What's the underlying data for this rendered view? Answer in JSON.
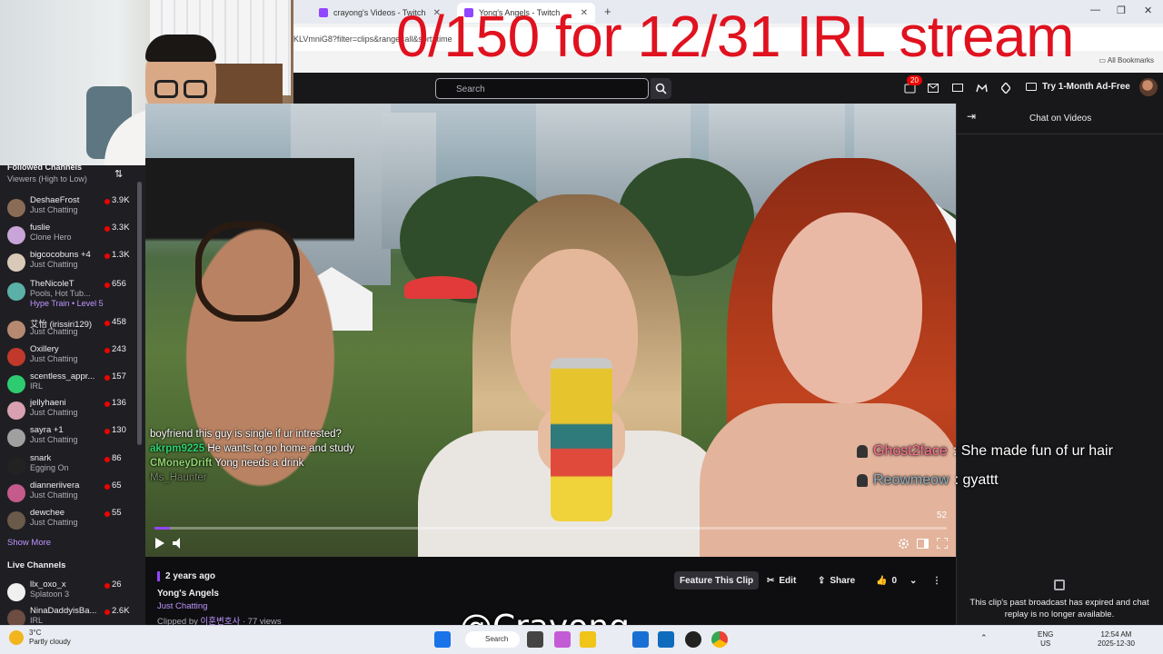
{
  "overlay": {
    "title": "0/150 for 12/31 IRL stream",
    "watermark": "@Crayong"
  },
  "browser": {
    "tabs": [
      {
        "label": "crayong's Videos - Twitch"
      },
      {
        "label": "Yong's Angels - Twitch"
      }
    ],
    "url": "KLVmniG8?filter=clips&range=all&sort=time",
    "bookmarks_label": "All Bookmarks"
  },
  "twitch_nav": {
    "search_placeholder": "Search",
    "notification_count": "20",
    "ad_free_label": "Try 1-Month Ad-Free"
  },
  "sidebar": {
    "title": "Followed Channels",
    "sort_label": "Viewers (High to Low)",
    "channels": [
      {
        "name": "DeshaeFrost",
        "game": "Just Chatting",
        "viewers": "3.9K",
        "avatar_color": "#8a6b55"
      },
      {
        "name": "fuslie",
        "game": "Clone Hero",
        "viewers": "3.3K",
        "avatar_color": "#c9a4d8"
      },
      {
        "name": "bigcocobuns +4",
        "game": "Just Chatting",
        "viewers": "1.3K",
        "avatar_color": "#d9c9b8"
      },
      {
        "name": "TheNicoleT",
        "game": "Pools, Hot Tub...",
        "extra": "Hype Train • Level 5",
        "viewers": "656",
        "avatar_color": "#5bb0a8"
      },
      {
        "name": "艾怡 (irissiri129)",
        "game": "Just Chatting",
        "viewers": "458",
        "avatar_color": "#b58a70"
      },
      {
        "name": "Oxillery",
        "game": "Just Chatting",
        "viewers": "243",
        "avatar_color": "#c0392b"
      },
      {
        "name": "scentless_appr...",
        "game": "IRL",
        "viewers": "157",
        "avatar_color": "#2ecc71"
      },
      {
        "name": "jellyhaeni",
        "game": "Just Chatting",
        "viewers": "136",
        "avatar_color": "#d8a0b0"
      },
      {
        "name": "sayra +1",
        "game": "Just Chatting",
        "viewers": "130",
        "avatar_color": "#a0a0a0"
      },
      {
        "name": "snark",
        "game": "Egging On",
        "viewers": "86",
        "avatar_color": "#222222"
      },
      {
        "name": "dianneriivera",
        "game": "Just Chatting",
        "viewers": "65",
        "avatar_color": "#c45b8a"
      },
      {
        "name": "dewchee",
        "game": "Just Chatting",
        "viewers": "55",
        "avatar_color": "#6a5a4a"
      }
    ],
    "show_more": "Show More",
    "live_header": "Live Channels",
    "live_channels": [
      {
        "name": "llx_oxo_x",
        "game": "Splatoon 3",
        "viewers": "26",
        "avatar_color": "#f0f0f0"
      },
      {
        "name": "NinaDaddyisBa...",
        "game": "IRL",
        "viewers": "2.6K",
        "avatar_color": "#6d4c41"
      }
    ]
  },
  "video": {
    "overlay_chat": [
      {
        "user": "",
        "text": "boyfriend this guy is single if ur intrested?"
      },
      {
        "user": "akrpm9225",
        "text": "He wants to go home and study"
      },
      {
        "user": "CMoneyDrift",
        "text": "Yong needs a drink"
      },
      {
        "user": "Ms_Haunter",
        "text": ""
      }
    ],
    "duration": "52",
    "progress": 0.02
  },
  "chat_panel": {
    "title": "Chat on Videos",
    "big_messages": [
      {
        "user": "Ghost2face",
        "text": ": She made fun of ur hair"
      },
      {
        "user": "Reowmeow",
        "text": ": gyattt"
      }
    ],
    "replay_notice": "This clip's past broadcast has expired and chat replay is no longer available."
  },
  "clip_info": {
    "age": "2 years ago",
    "title": "Yong's Angels",
    "category": "Just Chatting",
    "clipped_by_prefix": "Clipped by",
    "clipper": "이훈변호사",
    "views": " · 77 views",
    "feature_label": "Feature This Clip",
    "edit_label": "Edit",
    "share_label": "Share",
    "like_count": "0"
  },
  "taskbar": {
    "temperature": "3°C",
    "weather": "Partly cloudy",
    "search_label": "Search",
    "lang": "ENG",
    "region": "US",
    "time": "12:54 AM",
    "date": "2025-12-30"
  }
}
